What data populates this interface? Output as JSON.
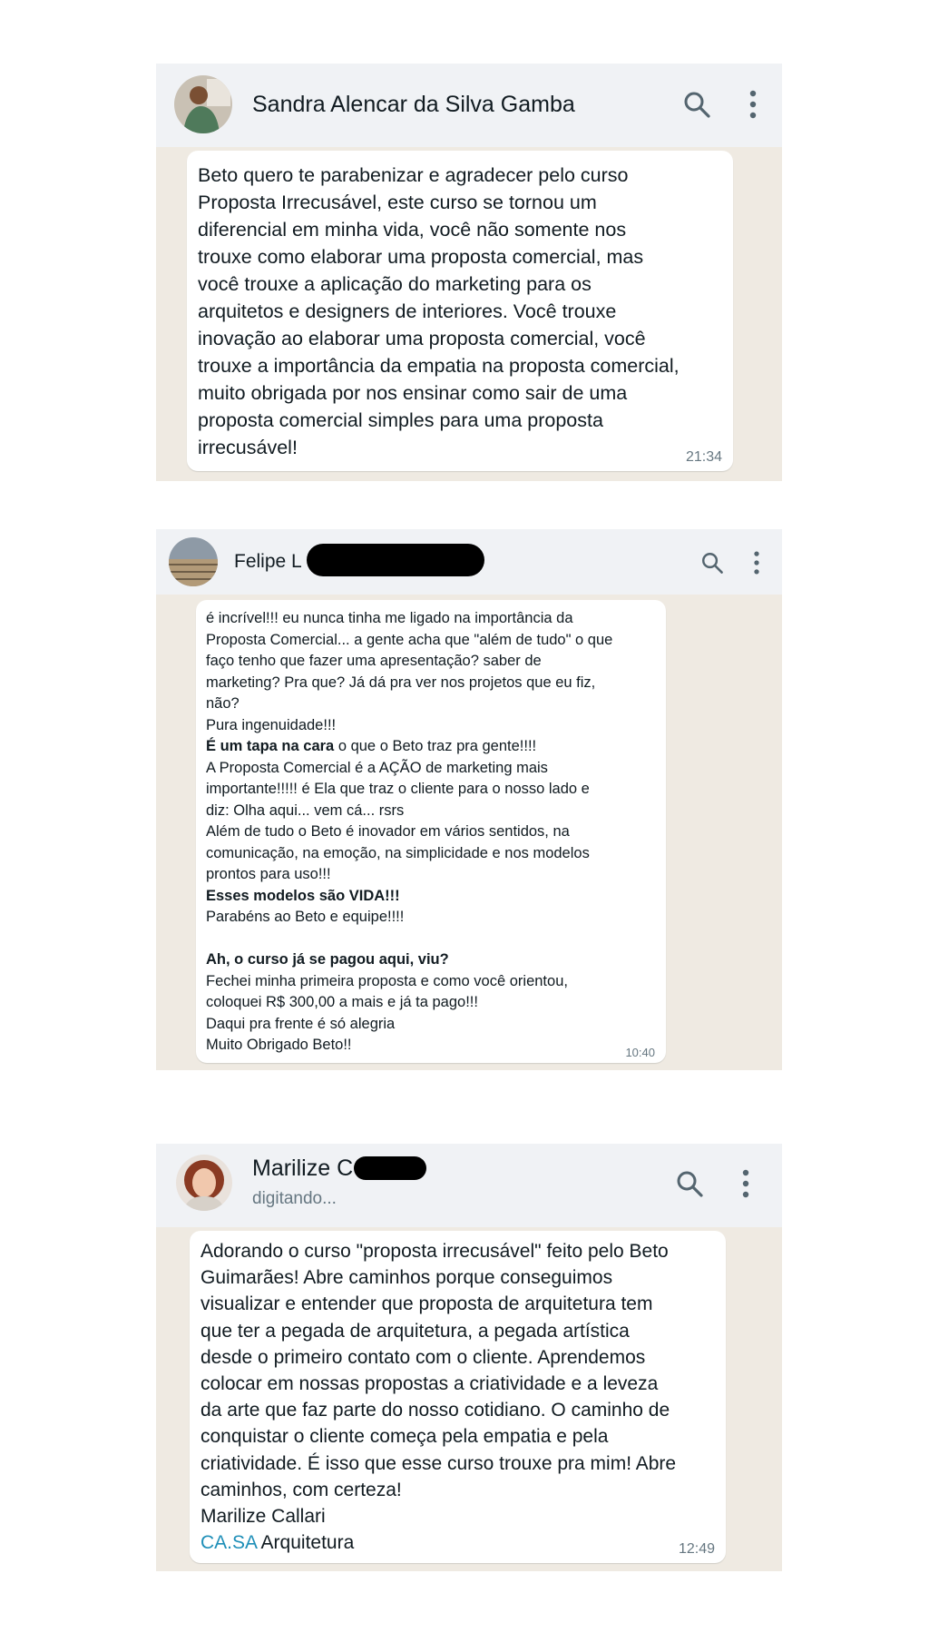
{
  "chats": [
    {
      "contact_name": "Sandra Alencar da Silva Gamba",
      "message": "Beto quero te parabenizar e agradecer pelo curso\nProposta Irrecusável, este curso se tornou um\ndiferencial em minha vida, você não somente nos\ntrouxe como elaborar uma proposta comercial, mas\nvocê trouxe a aplicação do marketing para os\narquitetos e designers de interiores. Você trouxe\ninovação ao elaborar uma proposta comercial, você\ntrouxe a importância da empatia na proposta comercial,\nmuito obrigada por nos ensinar como sair de uma\nproposta comercial simples para uma proposta\nirrecusável!",
      "time": "21:34"
    },
    {
      "contact_name": "Felipe  L",
      "message_lines": [
        {
          "text": "é incrível!!! eu nunca tinha me ligado na importância da"
        },
        {
          "text": "Proposta Comercial... a gente acha que \"além de tudo\" o que"
        },
        {
          "text": "faço tenho que fazer uma apresentação? saber de"
        },
        {
          "text": "marketing? Pra que? Já dá pra ver  nos projetos que eu fiz,"
        },
        {
          "text": "não?"
        },
        {
          "text": "Pura ingenuidade!!!"
        },
        {
          "bold": "É um tapa na cara",
          "text": " o que o Beto traz pra gente!!!!"
        },
        {
          "text": "A Proposta Comercial é a AÇÃO de marketing mais"
        },
        {
          "text": "importante!!!!! é Ela que traz o cliente para o nosso lado e"
        },
        {
          "text": "diz: Olha aqui... vem cá... rsrs"
        },
        {
          "text": "Além de tudo o Beto é inovador em vários sentidos, na"
        },
        {
          "text": "comunicação, na emoção, na simplicidade e nos modelos"
        },
        {
          "text": "prontos para uso!!!"
        },
        {
          "bold": "Esses modelos são VIDA!!!",
          "text": ""
        },
        {
          "text": "Parabéns ao Beto e equipe!!!!"
        },
        {
          "text": ""
        },
        {
          "bold": "Ah, o curso já se pagou aqui, viu?",
          "text": ""
        },
        {
          "text": "Fechei minha primeira proposta e como você orientou,"
        },
        {
          "text": "coloquei R$ 300,00 a mais e já ta pago!!!"
        },
        {
          "text": "Daqui pra frente é só alegria"
        },
        {
          "text": "Muito Obrigado Beto!!"
        }
      ],
      "time": "10:40"
    },
    {
      "contact_name": "Marilize C",
      "status": "digitando...",
      "message": "Adorando o curso \"proposta irrecusável\" feito pelo Beto\nGuimarães! Abre caminhos porque conseguimos\nvisualizar e entender que proposta de arquitetura tem\nque ter a pegada de arquitetura, a pegada artística\ndesde o primeiro contato com o cliente. Aprendemos\ncolocar em nossas propostas a criatividade e a leveza\nda arte que faz parte do nosso cotidiano. O caminho de\nconquistar o cliente começa pela empatia e pela\ncriatividade. É isso que esse curso trouxe pra mim! Abre\ncaminhos, com certeza!\nMarilize Callari",
      "signature_link": "CA.SA",
      "signature_rest": " Arquitetura",
      "time": "12:49"
    }
  ],
  "icons": {
    "search": "search-icon",
    "menu": "more-vertical-icon"
  },
  "colors": {
    "chat_bg": "#efeae2",
    "header_bg": "#f0f2f5",
    "link": "#1f8fb8"
  }
}
